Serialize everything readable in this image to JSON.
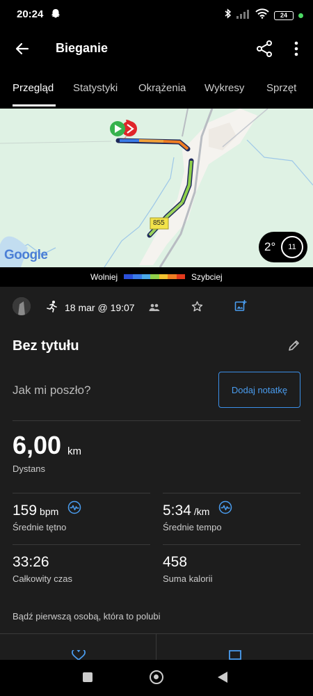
{
  "status_bar": {
    "time": "20:24",
    "battery": "24",
    "icons": [
      "ghost-icon",
      "bluetooth-icon",
      "signal-icon",
      "wifi-icon",
      "battery-icon"
    ],
    "dot_color": "#4cd964"
  },
  "app_bar": {
    "title": "Bieganie"
  },
  "tabs": [
    "Przegląd",
    "Statystyki",
    "Okrążenia",
    "Wykresy",
    "Sprzęt"
  ],
  "map": {
    "road_label": "855",
    "attribution": "Google",
    "weather": {
      "temp": "2°",
      "wind": "11"
    }
  },
  "legend": {
    "slow": "Wolniej",
    "fast": "Szybciej",
    "colors": [
      "#2b4fd8",
      "#3a7be8",
      "#4aa8e8",
      "#8fd04a",
      "#f2c230",
      "#ef7d22",
      "#e23a1c"
    ]
  },
  "activity": {
    "date": "18 mar @ 19:07",
    "title": "Bez tytułu",
    "question": "Jak mi poszło?",
    "note_button": "Dodaj notatkę",
    "distance": {
      "value": "6,00",
      "unit": "km",
      "label": "Dystans"
    },
    "stats": [
      {
        "value": "159",
        "unit": "bpm",
        "label": "Średnie tętno",
        "has_chart": true
      },
      {
        "value": "5:34",
        "unit": "/km",
        "label": "Średnie tempo",
        "has_chart": true
      },
      {
        "value": "33:26",
        "unit": "",
        "label": "Całkowity czas",
        "has_chart": false
      },
      {
        "value": "458",
        "unit": "",
        "label": "Suma kalorii",
        "has_chart": false
      }
    ],
    "like_prompt": "Bądź pierwszą osobą, która to polubi"
  },
  "colors": {
    "accent": "#4a9df0",
    "background": "#1d1d1d",
    "map_bg": "#dff2e4"
  }
}
